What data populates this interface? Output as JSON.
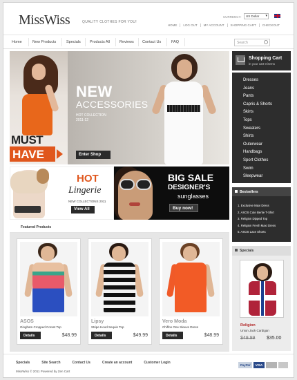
{
  "header": {
    "logo": "MissWiss",
    "tagline": "QUALITY CLOTHES FOR YOU!",
    "currency_label": "CURRENCY:",
    "currency_value": "US Dollar",
    "links": [
      "HOME",
      "LOG OUT",
      "MY ACCOUNT",
      "SHOPPING CART",
      "CHECKOUT"
    ]
  },
  "nav": {
    "items": [
      "Home",
      "New Products",
      "Specials",
      "Products All",
      "Reviews",
      "Contact Us",
      "FAQ"
    ],
    "search_placeholder": "Search"
  },
  "banners": {
    "left": {
      "line1": "MUST",
      "line2": "HAVE"
    },
    "main": {
      "title": "NEW",
      "subtitle": "ACCESSORIES",
      "collection": "HOT COLLECTION",
      "year": "2011-12",
      "button": "Enter Shop"
    },
    "lingerie": {
      "hot": "HOT",
      "title": "Lingerie",
      "collection": "NEW COLLECTIONS 2011",
      "button": "View All"
    },
    "sale": {
      "line1": "BIG SALE",
      "line2": "DESIGNER'S",
      "line3": "sunglasses",
      "button": "Buy now!"
    }
  },
  "featured": {
    "title": "Featured Products",
    "products": [
      {
        "brand": "ASOS",
        "name": "Gingham Cropped Corset Top",
        "button": "Details",
        "price": "$48.99"
      },
      {
        "brand": "Lipsy",
        "name": "Stripe Hood Sequin Top",
        "button": "Details",
        "price": "$49.99"
      },
      {
        "brand": "Vero Moda",
        "name": "Chiffon One Sleeve Dress",
        "button": "Details",
        "price": "$48.99"
      }
    ]
  },
  "cart": {
    "title": "Shopping Cart",
    "subtitle": "in your cart 0 items"
  },
  "categories": [
    "Dresses",
    "Jeans",
    "Pants",
    "Capris & Shorts",
    "Skirts",
    "Tops",
    "Sweaters",
    "Shirts",
    "Outerwear",
    "Handbags",
    "Sport Clothes",
    "Swim",
    "Sleepwear"
  ],
  "bestsellers": {
    "title": "Bestsellers",
    "items": [
      "1. Exclusive Maxi Dress",
      "2. ASOS Cute Bertie T-Shirt",
      "3. Religion Dipped Top",
      "4. Religion Fresh Maxi Dress",
      "5. ASOS Lace Shorts"
    ]
  },
  "specials": {
    "title": "Specials",
    "name": "Religion",
    "desc": "Union Jack Cardigan",
    "old_price": "$49.99",
    "new_price": "$35.00"
  },
  "footer": {
    "links": [
      "Specials",
      "Site Search",
      "Contact Us",
      "Create an account",
      "Customer Login"
    ],
    "copyright": "MissWiss © 2011  Powered by Zen Cart",
    "payments": [
      "PayPal",
      "VISA",
      "",
      ""
    ]
  }
}
